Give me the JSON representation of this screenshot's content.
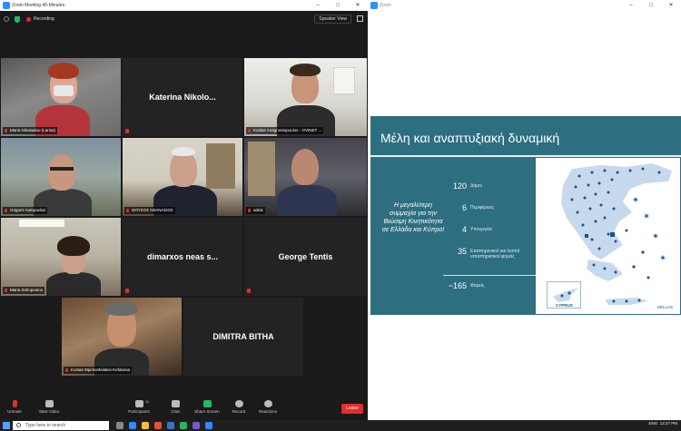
{
  "zoom_main": {
    "title": "Zoom Meeting 40-Minutes",
    "recording_label": "Recording",
    "view_button": "Speaker View",
    "participants": [
      {
        "name": "Maria Nikolaidou (Larisa)",
        "video": true
      },
      {
        "name": "Katerina Nikolo...",
        "video": false
      },
      {
        "name": "Kostas Anagnostopoulos - OVINET ...",
        "video": true,
        "active": true
      },
      {
        "name": "Grigoris Kalopoulos",
        "video": true
      },
      {
        "name": "ΘΟΥΣΟΣ ΑΘΑΝΑΣΙΟΣ",
        "video": true
      },
      {
        "name": "adiok",
        "video": true
      },
      {
        "name": "Maria Zahopoulou",
        "video": true
      },
      {
        "name": "dimarxos neas s...",
        "video": false
      },
      {
        "name": "George Tentis",
        "video": false
      },
      {
        "name": "Kostas Mpirkonfailakis-Kefalonia",
        "video": true
      },
      {
        "name": "DIMITRA BITHA",
        "video": false
      }
    ],
    "toolbar": {
      "unmute": "Unmute",
      "start_video": "Start Video",
      "participants": "Participants",
      "participants_count": "11",
      "chat": "Chat",
      "share_screen": "Share Screen",
      "record": "Record",
      "reactions": "Reactions",
      "leave": "Leave"
    }
  },
  "zoom_share": {
    "title": "Zoom",
    "slide": {
      "title": "Μέλη και αναπτυξιακή δυναμική",
      "alliance_text": "Η μεγαλύτερη συμμαχία για την Βιώσιμη Κινητικότητα σε Ελλάδα και Κύπρο!",
      "stats": [
        {
          "value": "120",
          "label": "Δήμοι"
        },
        {
          "value": "6",
          "label": "Περιφέρειες"
        },
        {
          "value": "4",
          "label": "Υπουργεία"
        },
        {
          "value": "35",
          "label": "Επιστημονικοί και λοιποί υποστηρικτικοί φορείς"
        }
      ],
      "total": {
        "value": "~165",
        "label": "Φορείς"
      },
      "map_labels": {
        "cyprus": "CYPRUS",
        "hellas": "HELLAS"
      }
    }
  },
  "taskbar": {
    "search_placeholder": "Type here to search",
    "time": "12:27 PM",
    "lang": "ENG"
  },
  "colors": {
    "slide_bg": "#2d6e80",
    "active_speaker": "#c3e03a",
    "leave": "#e02d2d",
    "map_blue": "#1f4f90"
  }
}
